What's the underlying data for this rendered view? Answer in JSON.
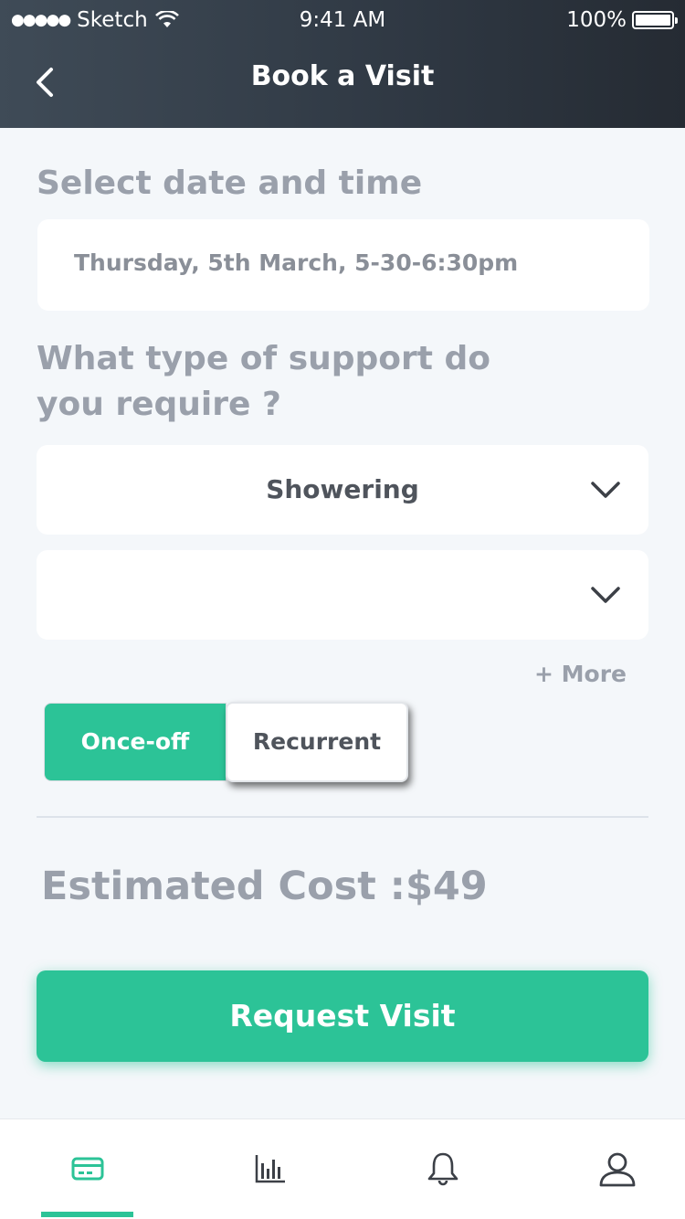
{
  "status_bar": {
    "carrier": "Sketch",
    "time": "9:41 AM",
    "battery": "100%"
  },
  "header": {
    "title": "Book a Visit",
    "back_icon": "chevron-left-icon"
  },
  "date_section": {
    "title": "Select date and time",
    "value": "Thursday, 5th March, 5-30-6:30pm"
  },
  "support_section": {
    "title_line1": "What type of support do",
    "title_line2": "you require ?",
    "select1_value": "Showering",
    "select2_value": "",
    "more_label": "+ More"
  },
  "frequency": {
    "options": [
      "Once-off",
      "Recurrent"
    ],
    "selected": "Once-off"
  },
  "cost": {
    "label": "Estimated Cost :$49"
  },
  "cta": {
    "label": "Request Visit"
  },
  "tab_bar": {
    "items": [
      "card-icon",
      "bar-chart-icon",
      "bell-icon",
      "user-icon"
    ],
    "active_index": 0
  },
  "colors": {
    "accent": "#2cc397",
    "header_bg": "#2f3843",
    "muted_text": "#9aa0ab"
  }
}
